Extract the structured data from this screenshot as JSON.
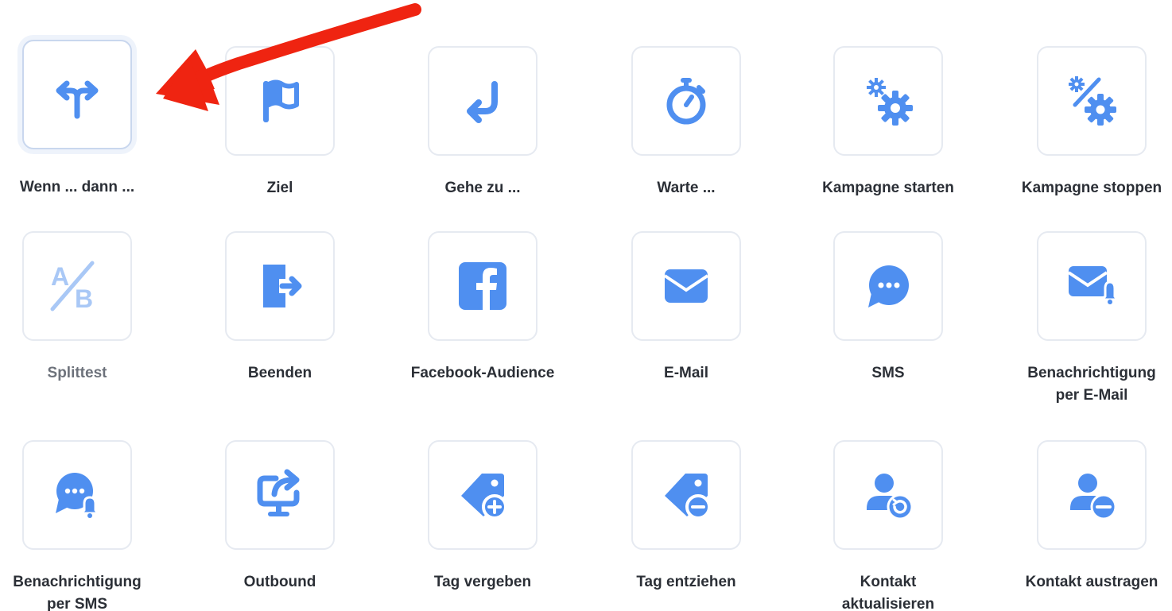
{
  "colors": {
    "icon": "#4f8ff0",
    "icon_faded": "#a9c8f6",
    "border": "#e6eaf1",
    "label": "#2b2f36",
    "label_muted": "#6d727b",
    "annotation_arrow": "#ef2411"
  },
  "tiles": [
    {
      "label": "Wenn ... dann ...",
      "icon": "split-arrow-icon",
      "selected": true
    },
    {
      "label": "Ziel",
      "icon": "flag-icon"
    },
    {
      "label": "Gehe zu ...",
      "icon": "return-arrow-icon"
    },
    {
      "label": "Warte ...",
      "icon": "stopwatch-icon"
    },
    {
      "label": "Kampagne starten",
      "icon": "gears-icon"
    },
    {
      "label": "Kampagne stoppen",
      "icon": "percent-gear-icon"
    },
    {
      "label": "Splittest",
      "icon": "ab-split-icon",
      "disabled": true
    },
    {
      "label": "Beenden",
      "icon": "exit-door-icon"
    },
    {
      "label": "Facebook-Audience",
      "icon": "facebook-icon"
    },
    {
      "label": "E-Mail",
      "icon": "envelope-icon"
    },
    {
      "label": "SMS",
      "icon": "chat-bubble-icon"
    },
    {
      "label": "Benachrichtigung\nper E-Mail",
      "icon": "envelope-bell-icon"
    },
    {
      "label": "Benachrichtigung\nper SMS",
      "icon": "chat-bell-icon"
    },
    {
      "label": "Outbound",
      "icon": "screen-share-icon"
    },
    {
      "label": "Tag vergeben",
      "icon": "tag-plus-icon"
    },
    {
      "label": "Tag entziehen",
      "icon": "tag-minus-icon"
    },
    {
      "label": "Kontakt\naktualisieren",
      "icon": "user-refresh-icon"
    },
    {
      "label": "Kontakt austragen",
      "icon": "user-minus-icon"
    }
  ]
}
